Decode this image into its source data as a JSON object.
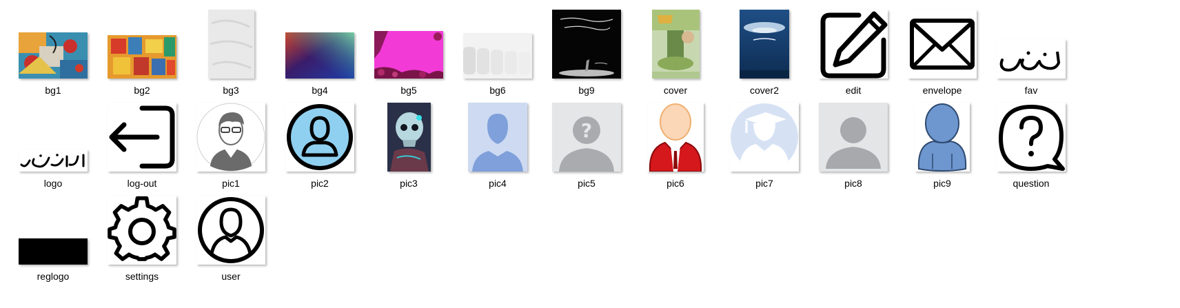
{
  "window": {
    "background": "#ffffff",
    "label_color": "#000000"
  },
  "files": [
    {
      "label": "bg1",
      "icon": "abstract-painting-thumbnail"
    },
    {
      "label": "bg2",
      "icon": "colorful-squares-thumbnail"
    },
    {
      "label": "bg3",
      "icon": "white-texture-thumbnail"
    },
    {
      "label": "bg4",
      "icon": "gradient-thumbnail"
    },
    {
      "label": "bg5",
      "icon": "pink-roses-thumbnail"
    },
    {
      "label": "bg6",
      "icon": "white-tiles-thumbnail"
    },
    {
      "label": "bg9",
      "icon": "black-poetry-thumbnail"
    },
    {
      "label": "cover",
      "icon": "book-cover-thumbnail"
    },
    {
      "label": "cover2",
      "icon": "blue-book-cover-thumbnail"
    },
    {
      "label": "edit",
      "icon": "edit-pencil-icon"
    },
    {
      "label": "envelope",
      "icon": "envelope-icon"
    },
    {
      "label": "fav",
      "icon": "urdu-calligraphy-icon"
    },
    {
      "label": "logo",
      "icon": "urdu-logo-thumbnail"
    },
    {
      "label": "log-out",
      "icon": "log-out-icon"
    },
    {
      "label": "pic1",
      "icon": "man-glasses-avatar"
    },
    {
      "label": "pic2",
      "icon": "blue-circle-user-avatar"
    },
    {
      "label": "pic3",
      "icon": "skull-art-thumbnail"
    },
    {
      "label": "pic4",
      "icon": "blue-silhouette-avatar"
    },
    {
      "label": "pic5",
      "icon": "unknown-user-avatar"
    },
    {
      "label": "pic6",
      "icon": "red-suit-avatar"
    },
    {
      "label": "pic7",
      "icon": "graduate-avatar"
    },
    {
      "label": "pic8",
      "icon": "grey-default-avatar"
    },
    {
      "label": "pic9",
      "icon": "blue-person-avatar"
    },
    {
      "label": "question",
      "icon": "question-bubble-icon"
    },
    {
      "label": "reglogo",
      "icon": "black-rectangle-thumbnail"
    },
    {
      "label": "settings",
      "icon": "gear-icon"
    },
    {
      "label": "user",
      "icon": "circle-user-icon"
    }
  ]
}
